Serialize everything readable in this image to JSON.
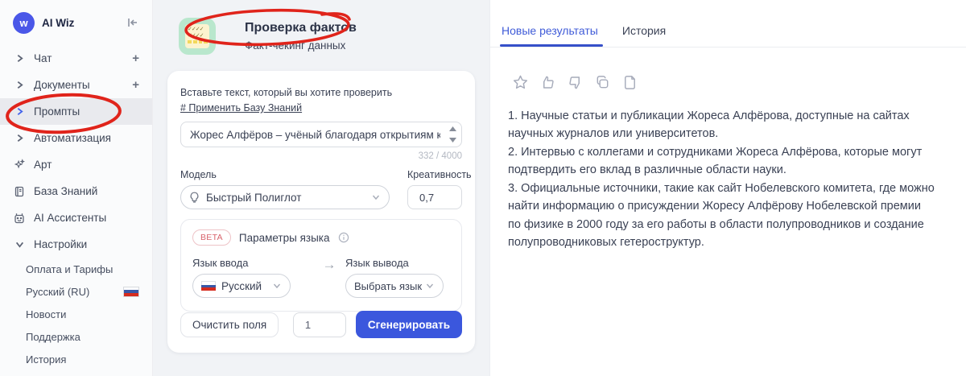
{
  "sidebar": {
    "logo_text": "AI Wiz",
    "items": [
      {
        "label": "Чат"
      },
      {
        "label": "Документы"
      },
      {
        "label": "Промпты"
      },
      {
        "label": "Автоматизация"
      },
      {
        "label": "Арт"
      },
      {
        "label": "База Знаний"
      },
      {
        "label": "AI Ассистенты"
      },
      {
        "label": "Настройки"
      }
    ],
    "settings_subitems": [
      {
        "label": "Оплата и Тарифы"
      },
      {
        "label": "Русский (RU)"
      },
      {
        "label": "Новости"
      },
      {
        "label": "Поддержка"
      },
      {
        "label": "История"
      }
    ]
  },
  "tool": {
    "title": "Проверка фактов",
    "subtitle": "Факт-чекинг данных",
    "input_label": "Вставьте текст, который вы хотите проверить",
    "kb_link": "# Применить Базу Знаний",
    "input_value": "Жорес Алфёров – учёный благодаря открытиям которого",
    "char_count": "332 / 4000",
    "model_label": "Модель",
    "model_value": "Быстрый Полиглот",
    "creativity_label": "Креативность",
    "creativity_value": "0,7",
    "beta_badge": "BETA",
    "lang_params_label": "Параметры языка",
    "lang_in_label": "Язык ввода",
    "lang_in_value": "Русский",
    "arrow": "→",
    "lang_out_label": "Язык вывода",
    "lang_out_value": "Выбрать язык",
    "clear_button": "Очистить поля",
    "count_value": "1",
    "generate_button": "Сгенерировать"
  },
  "results": {
    "tab_new": "Новые результаты",
    "tab_history": "История",
    "lines": [
      "1. Научные статьи и публикации Жореса Алфёрова, доступные на сайтах научных журналов или университетов.",
      "2. Интервью с коллегами и сотрудниками Жореса Алфёрова, которые могут подтвердить его вклад в различные области науки.",
      "3. Официальные источники, такие как сайт Нобелевского комитета, где можно найти информацию о присуждении Жоресу Алфёрову Нобелевской премии по физике в 2000 году за его работы в области полупроводников и создание полупроводниковых гетероструктур."
    ]
  },
  "colors": {
    "accent_blue": "#3b57dd",
    "logo_blue": "#4a57e8",
    "annotation_red": "#e0241b",
    "mint_icon_bg": "#b9e7cd",
    "flag_blue": "#3857a6",
    "flag_red": "#d52b1e"
  }
}
